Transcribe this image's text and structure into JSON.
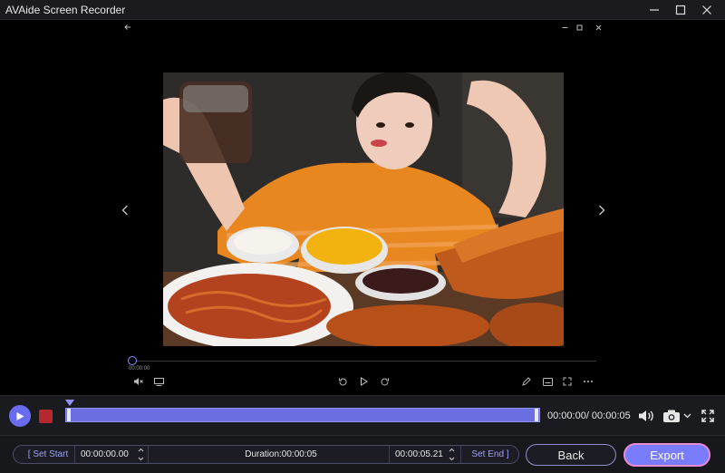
{
  "window": {
    "title": "AVAide Screen Recorder",
    "controls": [
      "minimize-icon",
      "maximize-icon",
      "close-icon"
    ]
  },
  "preview": {
    "current_time": "00:00:00",
    "top_icons": [
      "back-arrow-icon",
      "minimize-icon",
      "restore-icon",
      "close-icon"
    ],
    "left_controls": [
      "mute-icon",
      "subtitle-icon"
    ],
    "center_controls": [
      "rotate-left-icon",
      "play-icon",
      "rotate-right-icon"
    ],
    "right_controls": [
      "edit-icon",
      "caption-icon",
      "fullscreen-icon",
      "more-icon"
    ]
  },
  "timeline": {
    "time_display": "00:00:00/ 00:00:05",
    "icons": [
      "volume-icon",
      "camera-icon",
      "fullscreen-icon"
    ]
  },
  "clip": {
    "set_start_label": "[ Set Start",
    "start_time": "00:00:00.00",
    "duration_label": "Duration:00:00:05",
    "end_time": "00:00:05.21",
    "set_end_label": "Set End ]"
  },
  "actions": {
    "back_label": "Back",
    "export_label": "Export"
  },
  "colors": {
    "accent": "#6a6cf0",
    "stop": "#b5282e",
    "export_border": "#e98ad6"
  }
}
